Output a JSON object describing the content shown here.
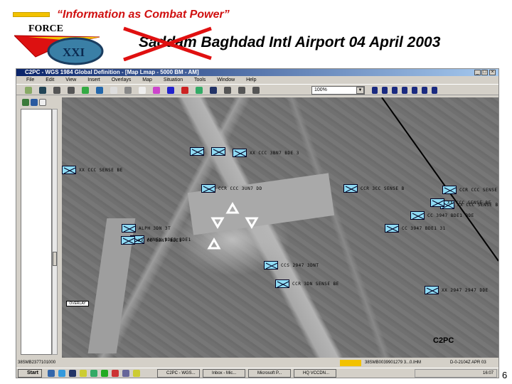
{
  "slide": {
    "motto": "“Information as Combat Power”",
    "title": "Saddam Baghdad Intl Airport 04 April 2003",
    "page_number": "6",
    "logo_text": [
      "FORCE",
      "XXI"
    ]
  },
  "window": {
    "title": "C2PC - WGS 1984 Global Definition - [Map Lmap - 5000 BM - AM]",
    "menu": [
      "File",
      "Edit",
      "View",
      "Insert",
      "Overlays",
      "Map",
      "Situation",
      "Tools",
      "Window",
      "Help"
    ],
    "zoom_value": "100%",
    "map_watermark": "C2PC",
    "legend_box": "OVERLAY",
    "units": [
      {
        "label": ""
      },
      {
        "label": ""
      },
      {
        "label": "XX CCC 3BN7 BDE 3"
      },
      {
        "label": "XX CCC SENSE BE"
      },
      {
        "label": "CCR CCC 3UN7 DD"
      },
      {
        "label": "CCR 3CC SENSE B"
      },
      {
        "label": "CCR CCC SENSE"
      },
      {
        "label": "XX CCC SENSE BDE"
      },
      {
        "label": "CC 3947 BDE1 BDE"
      },
      {
        "label": "XX CCC SENSE BE"
      },
      {
        "label": "CC 3947 BDE1 31"
      },
      {
        "label": "ALPH 3DN 3T"
      },
      {
        "label": "ANNEX BDE3 BDE1"
      },
      {
        "label": "CCS 2947 3DNT"
      },
      {
        "label": "CCR 3DN SENSE BE"
      },
      {
        "label": "XX 2947 2947 DDE"
      },
      {
        "label": "XX CC 3BN7 BDE1"
      }
    ],
    "status": {
      "left": "38SMB2377101000",
      "mid": "38SMB0039901279 3...0.IHM",
      "right": "D-0-2104Z APR 03"
    },
    "taskbar": {
      "start": "Start",
      "tasks": [
        "C2PC - WGS...",
        "Inbox - Mic...",
        "Microsoft P...",
        "HQ VCCDN..."
      ],
      "clock": "16:07"
    }
  },
  "colors": {
    "motto": "#d01010",
    "unit_fill": "#8fdcf5",
    "titlebar": "#0a246a",
    "strike": "#e01010"
  }
}
